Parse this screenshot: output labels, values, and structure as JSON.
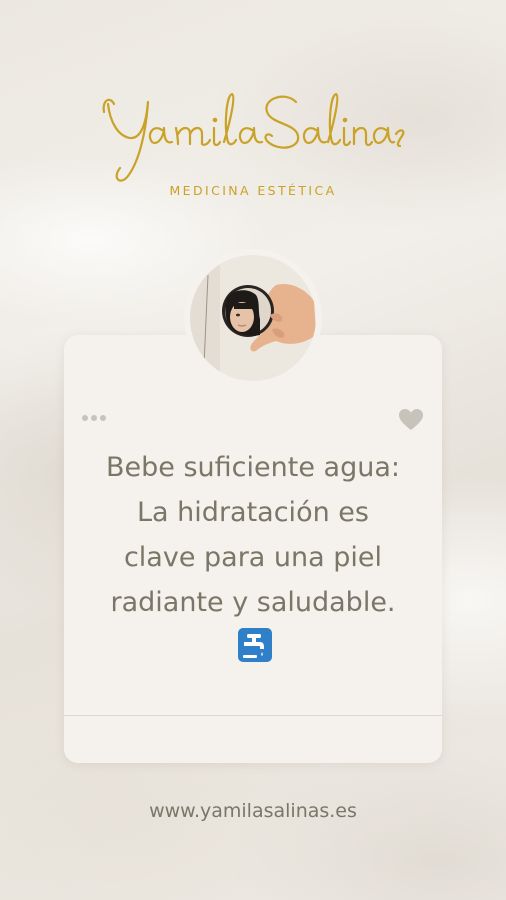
{
  "brand": {
    "name": "Yamila Salinas",
    "tagline": "MEDICINA ESTÉTICA",
    "accent_color": "#c9a227"
  },
  "post": {
    "message": "Bebe suficiente agua: La hidratación es clave para una piel radiante y saludable.",
    "emoji_icon": "potable-water-icon",
    "menu_icon": "more-dots-icon",
    "like_icon": "heart-icon",
    "avatar": "profile-photo-mirror"
  },
  "footer": {
    "website": "www.yamilasalinas.es"
  }
}
